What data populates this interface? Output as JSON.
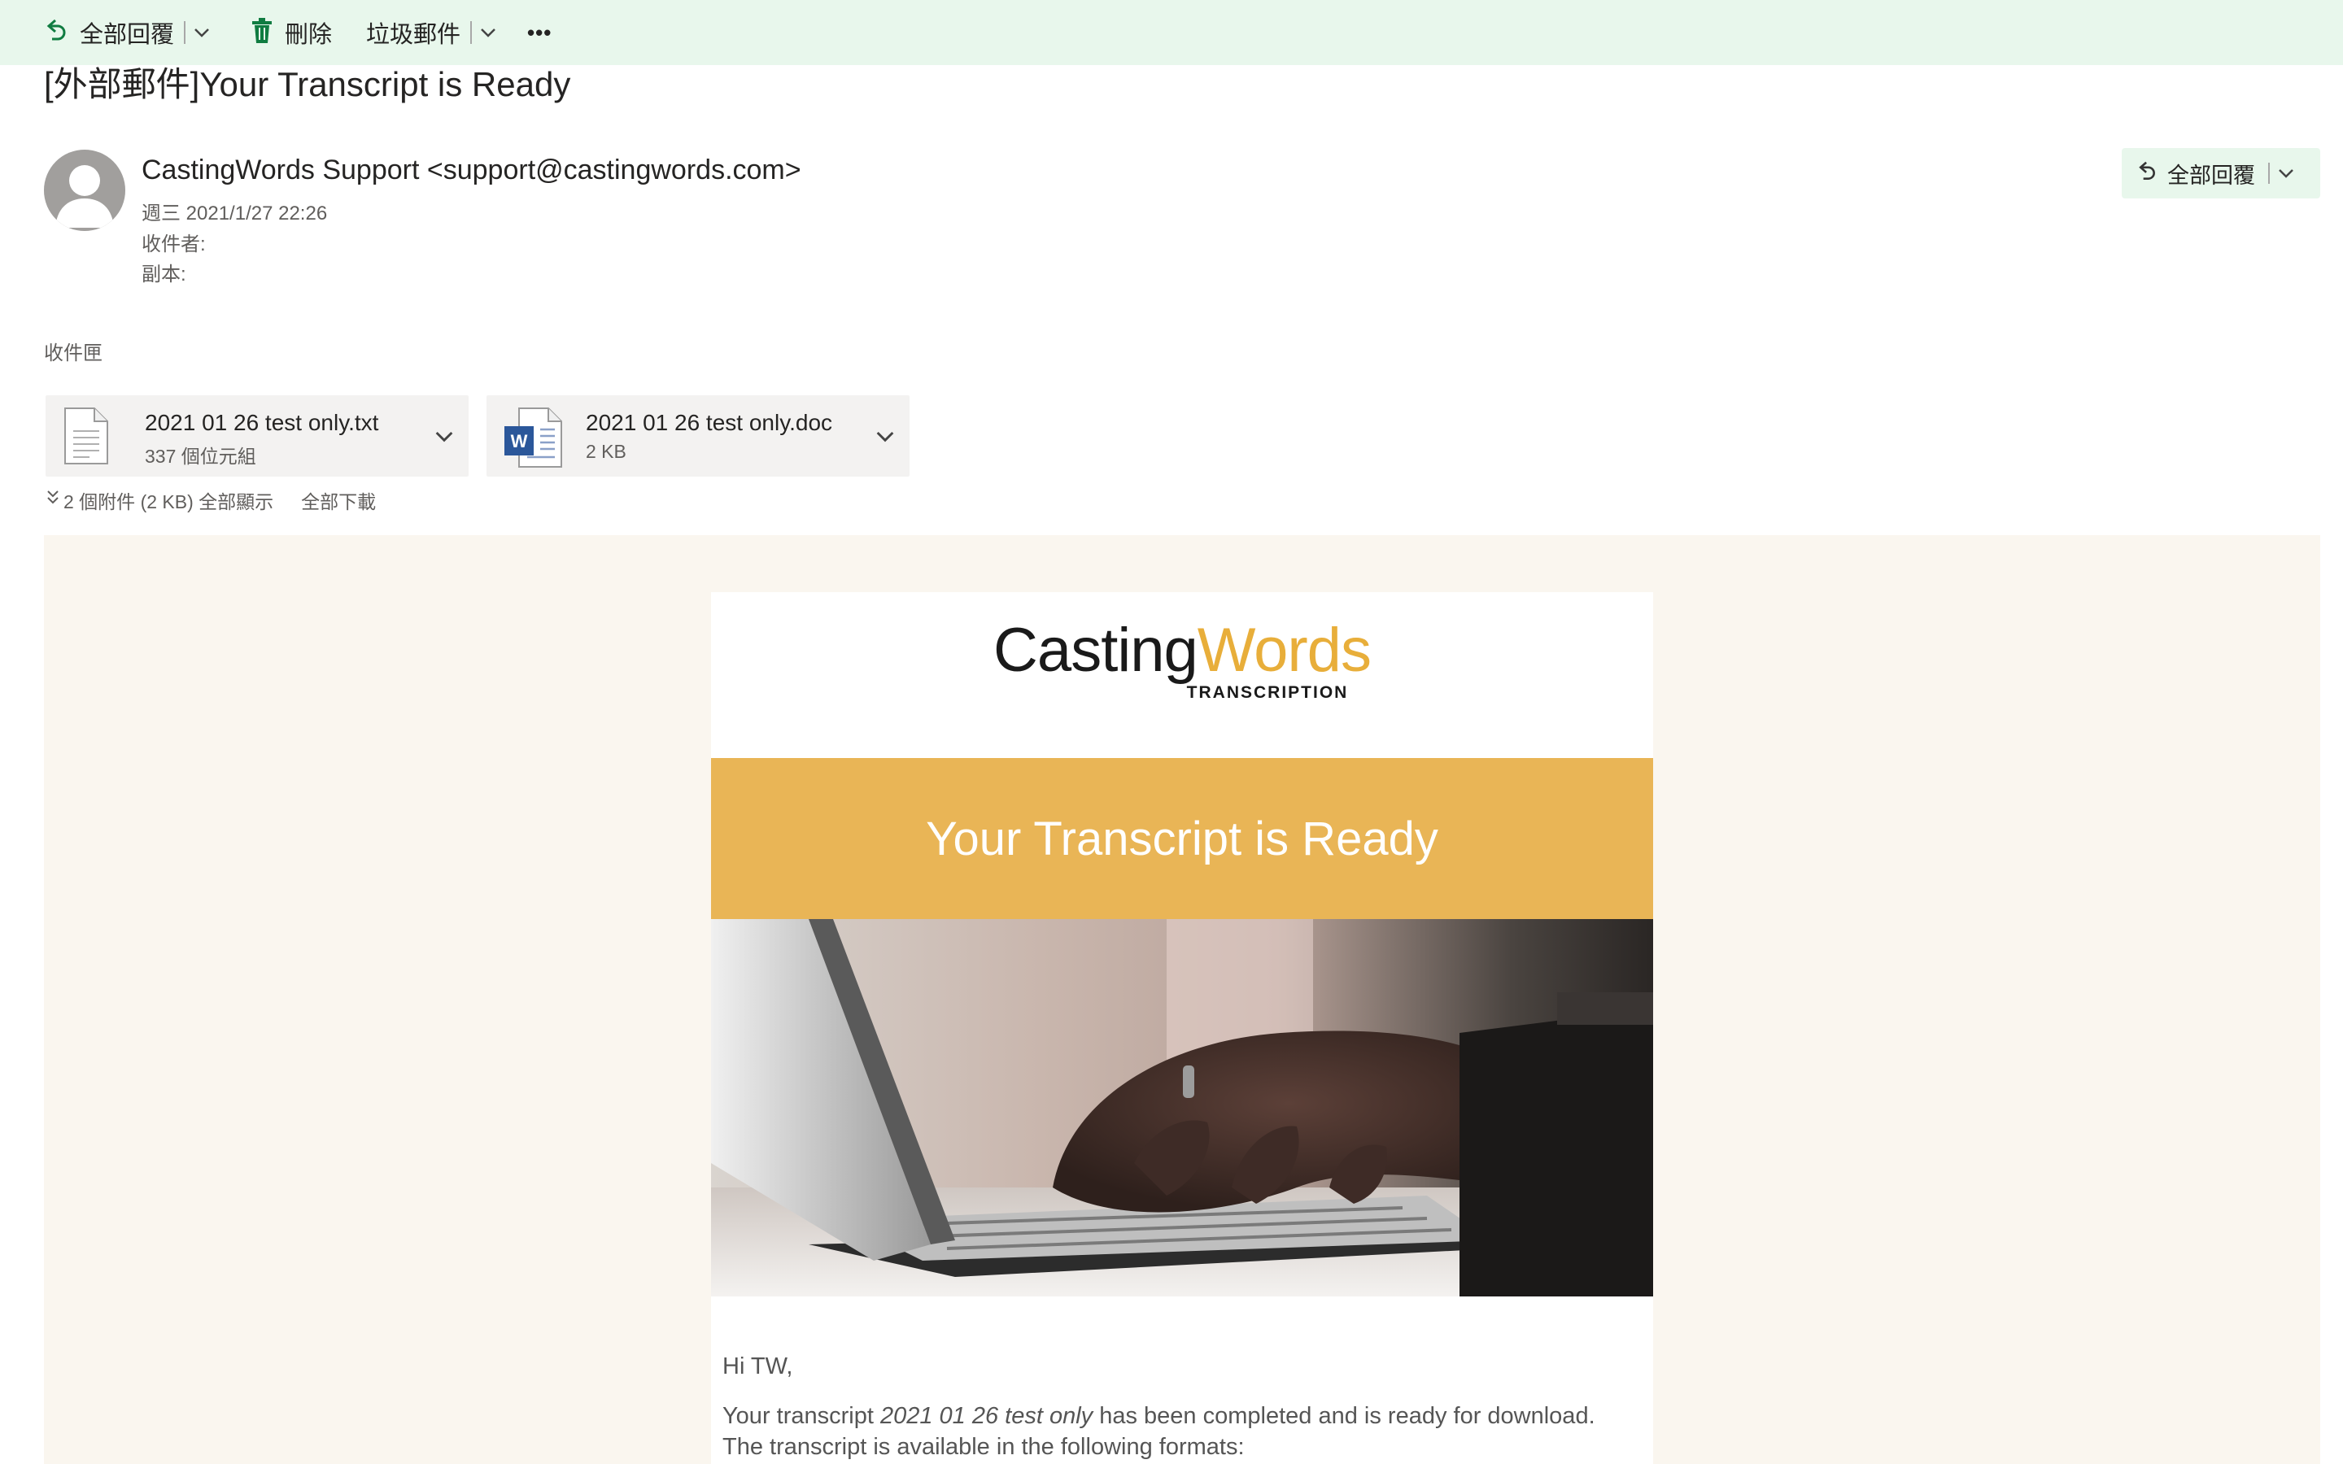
{
  "toolbar": {
    "reply_all": "全部回覆",
    "delete": "刪除",
    "junk": "垃圾郵件",
    "more": "•••"
  },
  "message": {
    "subject": "[外部郵件]Your Transcript is Ready",
    "sender": "CastingWords Support <support@castingwords.com>",
    "date": "週三 2021/1/27 22:26",
    "to_label": "收件者:",
    "cc_label": "副本:",
    "reply_all_button": "全部回覆",
    "folder": "收件匣"
  },
  "attachments": {
    "items": [
      {
        "name": "2021 01 26 test only.txt",
        "size": "337 個位元組",
        "icon": "text-file-icon"
      },
      {
        "name": "2021 01 26 test only.doc",
        "size": "2 KB",
        "icon": "word-file-icon"
      }
    ],
    "summary": "2 個附件 (2 KB) 全部顯示",
    "download_all": "全部下載"
  },
  "email": {
    "logo": {
      "casting": "Casting",
      "words": "Words",
      "sub": "TRANSCRIPTION"
    },
    "banner_title": "Your Transcript is Ready",
    "greeting": "Hi TW,",
    "para_before": "Your transcript ",
    "para_title": "2021 01 26 test only",
    "para_after": " has been completed and is ready for download. The transcript is available in the following formats:"
  },
  "colors": {
    "toolbar_bg": "#e8f7ec",
    "accent_green": "#107c41",
    "banner": "#e9b556",
    "logo_words": "#e8ae3a",
    "body_bg": "#faf6ef"
  }
}
